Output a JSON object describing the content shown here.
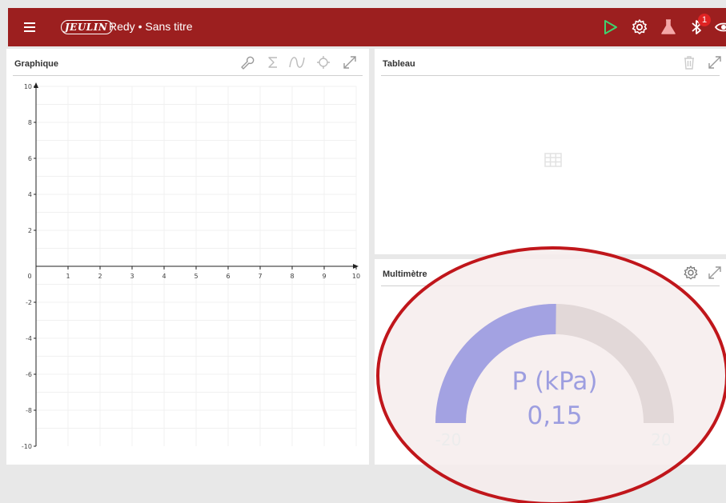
{
  "topbar": {
    "logo_text": "JEULIN",
    "title": "Redy • Sans titre",
    "notification_count": "1",
    "icons": [
      "menu-icon",
      "play-icon",
      "settings-icon",
      "flask-icon",
      "bluetooth-icon",
      "eye-icon"
    ],
    "colors": {
      "bar": "#9c1f1f",
      "play": "#3fd26e",
      "flask": "#f4a7a7"
    }
  },
  "graph_panel": {
    "title": "Graphique",
    "toolbar_icons": [
      "wrench-icon",
      "sigma-icon",
      "curve-icon",
      "target-icon",
      "expand-icon"
    ]
  },
  "table_panel": {
    "title": "Tableau",
    "toolbar_icons": [
      "trash-icon",
      "expand-icon"
    ],
    "placeholder_icon": "table-icon"
  },
  "multimeter_panel": {
    "title": "Multimètre",
    "toolbar_icons": [
      "settings-icon",
      "expand-icon"
    ],
    "gauge": {
      "label": "P (kPa)",
      "value_text": "0,15",
      "value": 0.15,
      "min_label": "-20",
      "max_label": "20",
      "min": -20,
      "max": 20,
      "fill_color": "#a3a2e2",
      "track_color": "#e2d8d8"
    }
  },
  "chart_data": {
    "type": "line",
    "title": "",
    "xlabel": "",
    "ylabel": "",
    "xlim": [
      0,
      10
    ],
    "ylim": [
      -10,
      10
    ],
    "x_ticks": [
      "0",
      "1",
      "2",
      "3",
      "4",
      "5",
      "6",
      "7",
      "8",
      "9",
      "10"
    ],
    "y_ticks": [
      "10",
      "8",
      "6",
      "4",
      "2",
      "-2",
      "-4",
      "-6",
      "-8",
      "-10"
    ],
    "grid": true,
    "series": []
  },
  "annotation": {
    "shape": "ellipse",
    "color": "#c0161b",
    "target": "multimeter-gauge"
  }
}
